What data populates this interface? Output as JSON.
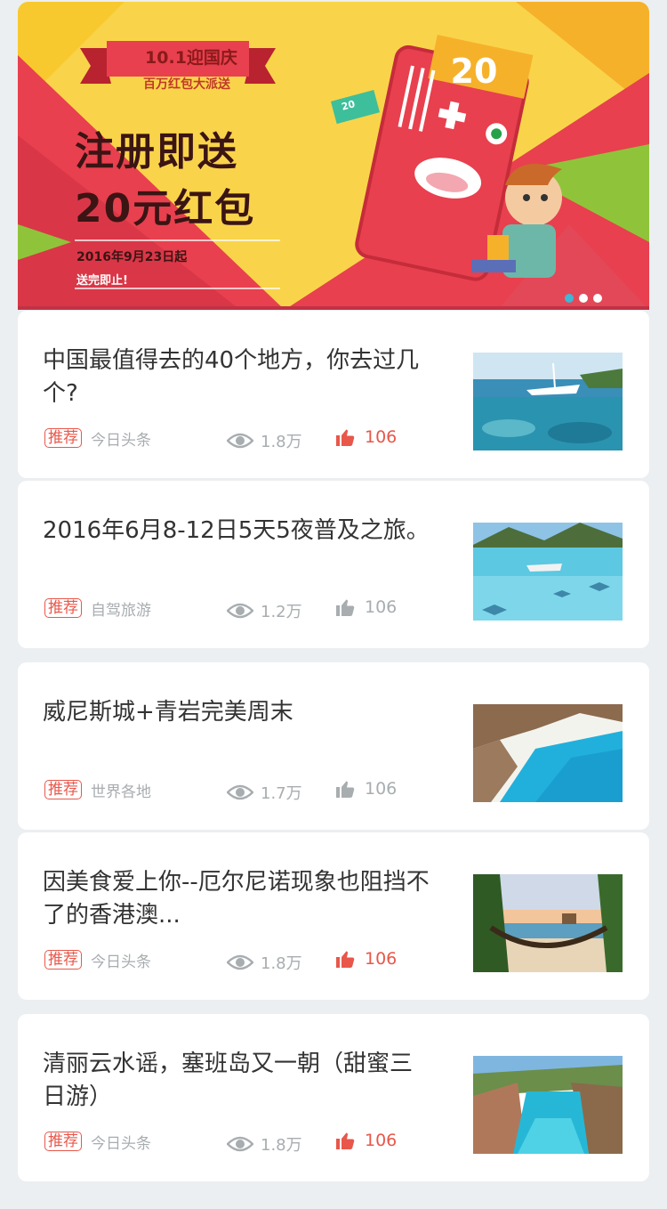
{
  "banner": {
    "ribbon": "10.1迎国庆",
    "ribbon_sub": "百万红包大派送",
    "headline_1": "注册即送",
    "headline_2": "20元红包",
    "date": "2016年9月23日起",
    "note": "送完即止!",
    "badge_amount": "20",
    "mini_amount": "20",
    "carousel": {
      "count": 3,
      "active": 1
    },
    "colors": {
      "yellow": "#f9d44a",
      "red": "#e8404e",
      "green": "#8fc43a",
      "active_dot": "#3fb7d6"
    }
  },
  "articles": [
    {
      "title": "中国最值得去的40个地方，你去过几个?",
      "tag": "推荐",
      "source": "今日头条",
      "views": "1.8万",
      "likes": "106",
      "liked": true,
      "thumb": "boat-reef"
    },
    {
      "title": "2016年6月8-12日5天5夜普及之旅。",
      "tag": "推荐",
      "source": "自驾旅游",
      "views": "1.2万",
      "likes": "106",
      "liked": false,
      "thumb": "stingray-lagoon"
    },
    {
      "title": "威尼斯城+青岩完美周末",
      "tag": "推荐",
      "source": "世界各地",
      "views": "1.7万",
      "likes": "106",
      "liked": false,
      "thumb": "cliff-beach"
    },
    {
      "title": "因美食爱上你--厄尔尼诺现象也阻挡不了的香港澳...",
      "tag": "推荐",
      "source": "今日头条",
      "views": "1.8万",
      "likes": "106",
      "liked": true,
      "thumb": "hammock-sunset"
    },
    {
      "title": "清丽云水谣，塞班岛又一朝（甜蜜三日游）",
      "tag": "推荐",
      "source": "今日头条",
      "views": "1.8万",
      "likes": "106",
      "liked": true,
      "thumb": "cove-bay"
    }
  ],
  "colors": {
    "tag": "#e8574a",
    "muted": "#a8adb0",
    "like_active": "#e8574a",
    "page_bg": "#eceff1"
  }
}
